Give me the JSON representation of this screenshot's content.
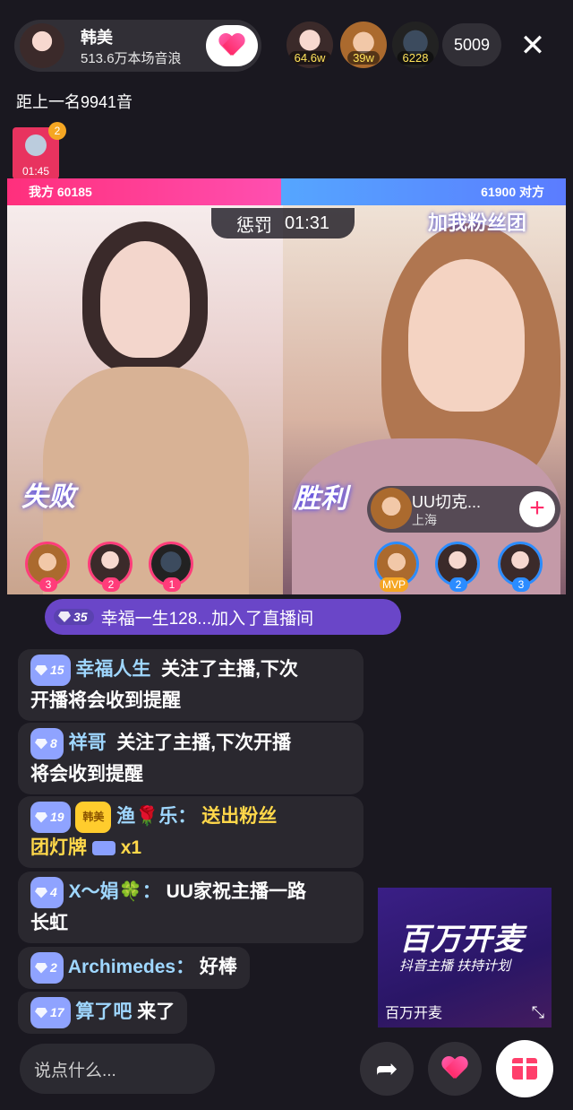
{
  "host": {
    "name": "韩美",
    "subtitle": "513.6万本场音浪"
  },
  "viewers": [
    {
      "badge": "64.6w"
    },
    {
      "badge": "39w"
    },
    {
      "badge": "6228"
    }
  ],
  "viewer_count": "5009",
  "rank_text": "距上一名9941音",
  "timer_badge": {
    "count": "2",
    "time": "01:45"
  },
  "pk": {
    "left_label": "我方 60185",
    "right_label": "61900 对方",
    "left_ratio": 0.49,
    "timer_label": "惩罚",
    "timer_value": "01:31"
  },
  "results": {
    "left": "失败",
    "right": "胜利"
  },
  "right_banner": "加我粉丝团",
  "opponent": {
    "name": "UU切克...",
    "city": "上海"
  },
  "left_gifters": [
    "3",
    "2",
    "1"
  ],
  "right_gifters": [
    "MVP",
    "2",
    "3"
  ],
  "join_notice": {
    "level": "35",
    "text": "幸福一生128...加入了直播间"
  },
  "messages": [
    {
      "level": "15",
      "user": "幸福人生",
      "text": "关注了主播,下次开播将会收到提醒",
      "line1": "关注了主播,下次",
      "line2": "开播将会收到提醒"
    },
    {
      "level": "8",
      "user": "祥哥",
      "line1": "关注了主播,下次开播",
      "line2": "将会收到提醒"
    },
    {
      "level": "19",
      "fan": "韩美",
      "user": "渔🌹乐：",
      "line1": "送出粉丝",
      "line2": "团灯牌",
      "gift_count": "x1"
    },
    {
      "level": "4",
      "user": "X～娟🍀：",
      "line1": "UU家祝主播一路",
      "line2": "长虹"
    },
    {
      "level": "2",
      "user": "Archimedes：",
      "line1": "好棒"
    },
    {
      "level": "17",
      "user": "算了吧",
      "line1": "来了"
    }
  ],
  "ad": {
    "title": "百万开麦",
    "slogan": "抖音主播 扶持计划",
    "caption": "百万开麦"
  },
  "input": {
    "placeholder": "说点什么..."
  },
  "colors": {
    "pk_left": "#ff2f7c",
    "pk_right": "#5b7cff",
    "join_bg": "#6a46c8",
    "gift_text": "#ffd84a",
    "username": "#9fd7ff"
  },
  "icons": [
    "close-icon",
    "share-icon",
    "heart-icon",
    "gift-icon",
    "expand-icon",
    "plus-icon"
  ]
}
